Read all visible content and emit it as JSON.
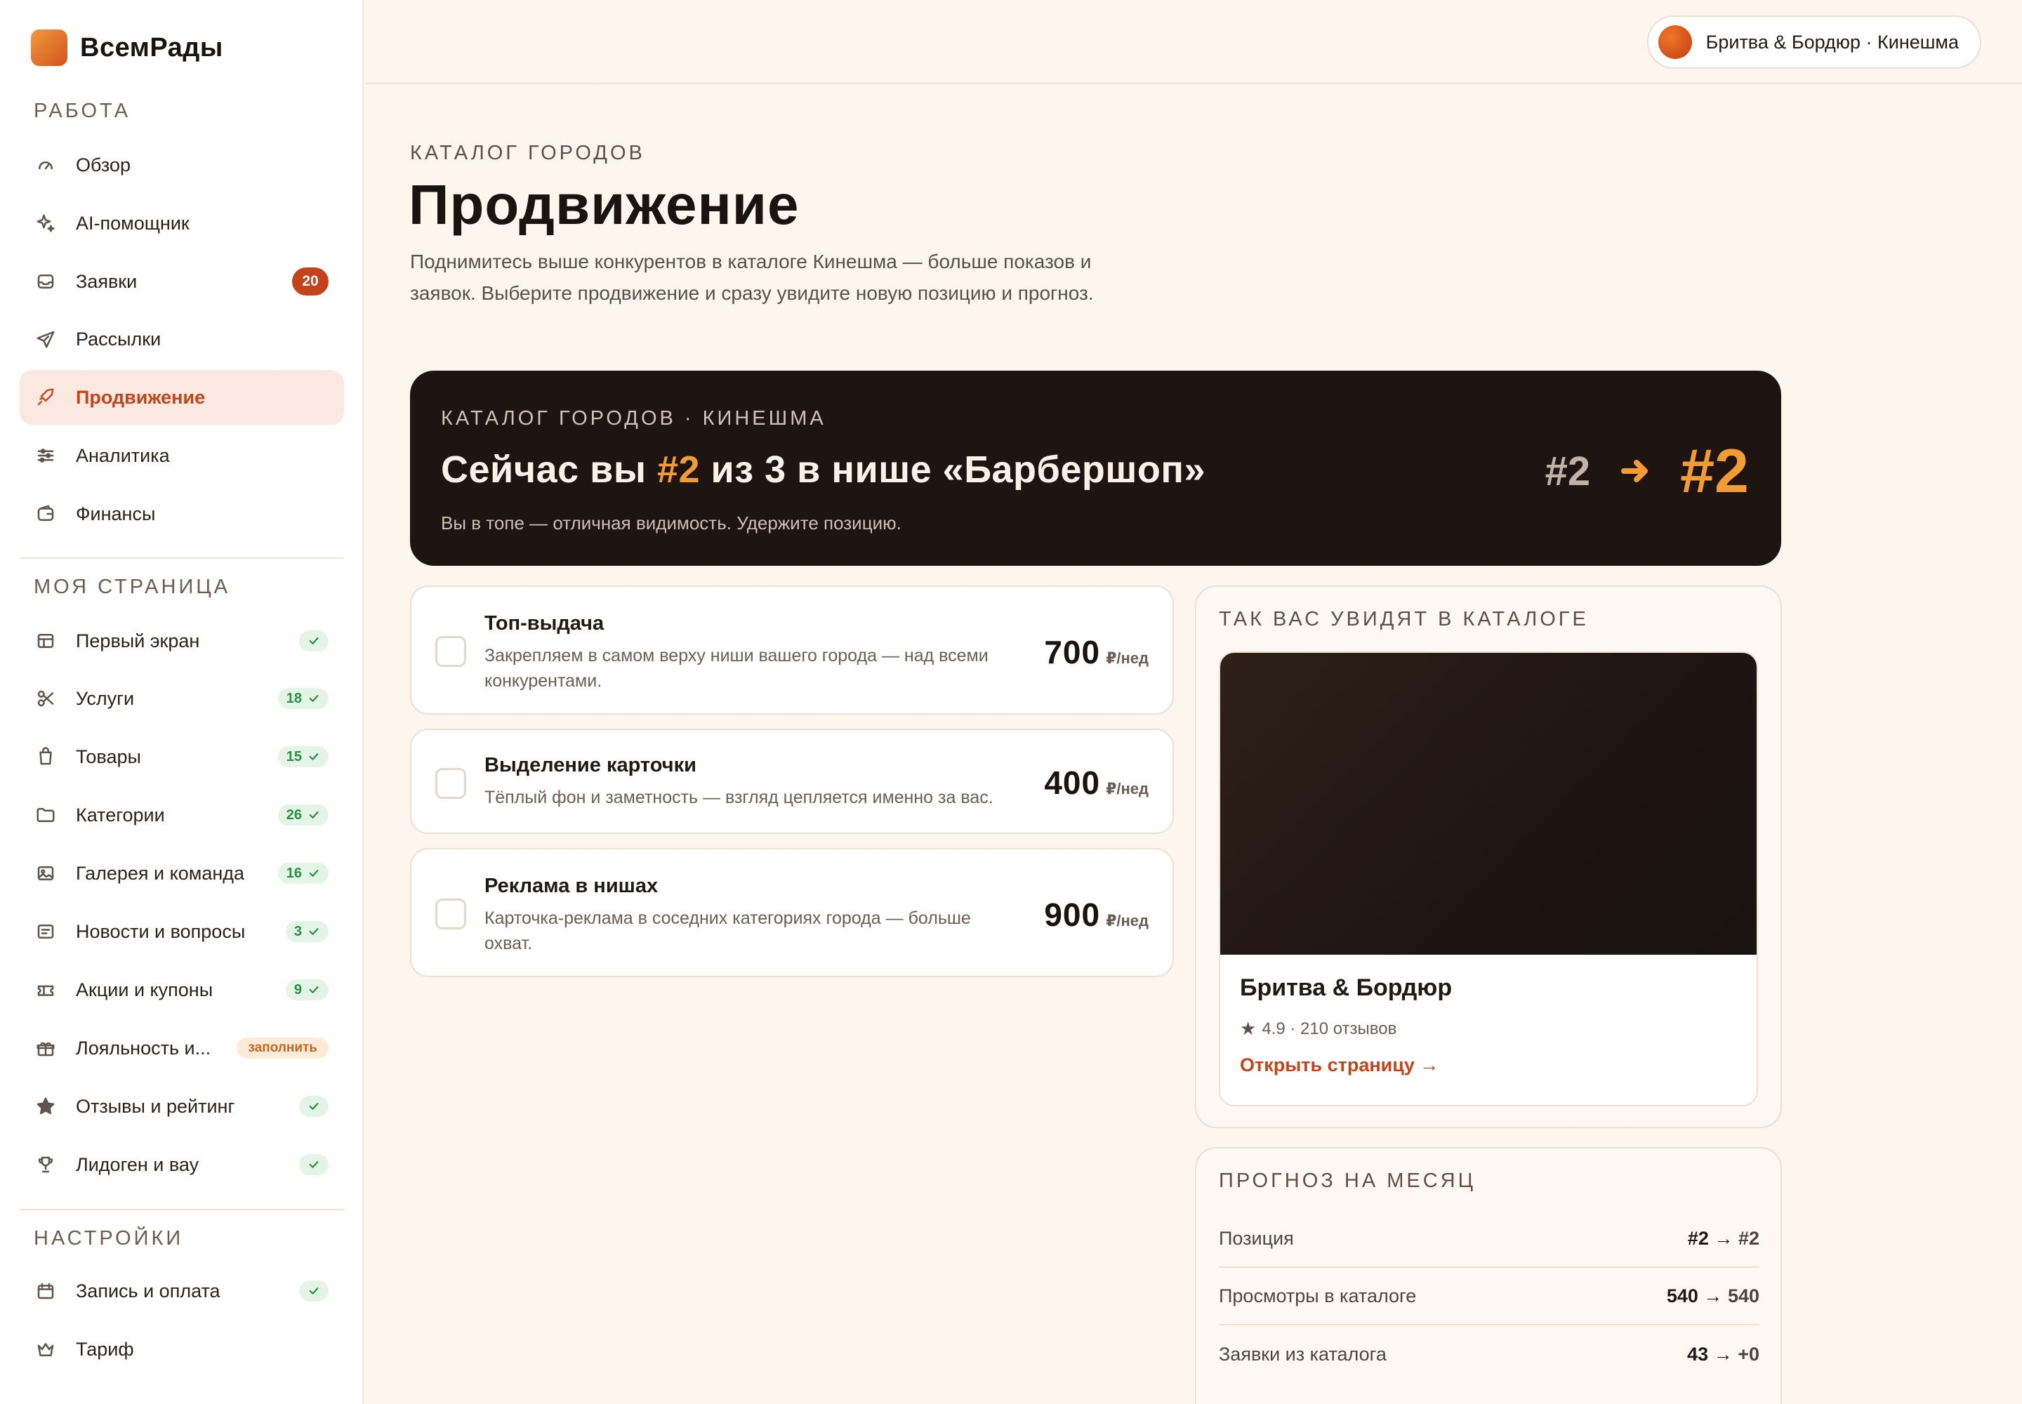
{
  "app": {
    "name": "ВсемРады",
    "brand_color": "#d2541c",
    "accent_color": "#f29c33"
  },
  "sidebar": {
    "sections": {
      "work": "РАБОТА",
      "my_page": "МОЯ СТРАНИЦА",
      "settings": "НАСТРОЙКИ"
    },
    "work_items": [
      {
        "label": "Обзор",
        "icon": "gauge-icon"
      },
      {
        "label": "AI-помощник",
        "icon": "sparkle-icon"
      },
      {
        "label": "Заявки",
        "icon": "inbox-icon",
        "badge": "20"
      },
      {
        "label": "Рассылки",
        "icon": "send-icon"
      },
      {
        "label": "Продвижение",
        "icon": "rocket-icon",
        "active": true
      },
      {
        "label": "Аналитика",
        "icon": "sliders-icon"
      },
      {
        "label": "Финансы",
        "icon": "wallet-icon"
      }
    ],
    "page_items": [
      {
        "label": "Первый экран",
        "icon": "layout-icon",
        "status": ""
      },
      {
        "label": "Услуги",
        "icon": "scissors-icon",
        "status": "18"
      },
      {
        "label": "Товары",
        "icon": "bag-icon",
        "status": "15"
      },
      {
        "label": "Категории",
        "icon": "folder-icon",
        "status": "26"
      },
      {
        "label": "Галерея и команда",
        "icon": "image-icon",
        "status": "16"
      },
      {
        "label": "Новости и вопросы",
        "icon": "news-icon",
        "status": "3"
      },
      {
        "label": "Акции и купоны",
        "icon": "ticket-icon",
        "status": "9"
      },
      {
        "label": "Лояльность и...",
        "icon": "gift-icon",
        "status_text": "заполнить"
      },
      {
        "label": "Отзывы и рейтинг",
        "icon": "star-icon",
        "status": ""
      },
      {
        "label": "Лидоген и вау",
        "icon": "trophy-icon",
        "status": ""
      }
    ],
    "settings_items": [
      {
        "label": "Запись и оплата",
        "icon": "calendar-icon",
        "status": ""
      },
      {
        "label": "Тариф",
        "icon": "crown-icon"
      }
    ]
  },
  "topbar": {
    "business": "Бритва & Бордюр · Кинешма"
  },
  "main": {
    "eyebrow": "КАТАЛОГ ГОРОДОВ",
    "title": "Продвижение",
    "description": "Поднимитесь выше конкурентов в каталоге Кинешма — больше показов и заявок. Выберите продвижение и сразу увидите новую позицию и прогноз.",
    "hero": {
      "eyebrow": "КАТАЛОГ ГОРОДОВ · КИНЕШМА",
      "title_pre": "Сейчас вы ",
      "title_rank": "#2",
      "title_post": " из 3 в нише «Барбершоп»",
      "subtitle": "Вы в топе — отличная видимость. Удержите позицию.",
      "rank_from": "#2",
      "rank_to": "#2"
    },
    "options": [
      {
        "title": "Топ-выдача",
        "desc": "Закрепляем в самом верху ниши вашего города — над всеми конкурентами.",
        "price": "700",
        "unit": "₽/нед"
      },
      {
        "title": "Выделение карточки",
        "desc": "Тёплый фон и заметность — взгляд цепляется именно за вас.",
        "price": "400",
        "unit": "₽/нед"
      },
      {
        "title": "Реклама в нишах",
        "desc": "Карточка-реклама в соседних категориях города — больше охват.",
        "price": "900",
        "unit": "₽/нед"
      }
    ],
    "preview": {
      "eyebrow": "ТАК ВАС УВИДЯТ В КАТАЛОГЕ",
      "name": "Бритва & Бордюр",
      "rating": "4.9 · 210 отзывов",
      "link": "Открыть страницу →"
    },
    "forecast": {
      "eyebrow": "ПРОГНОЗ НА МЕСЯЦ",
      "rows": [
        {
          "label": "Позиция",
          "from": "#2",
          "to": "#2"
        },
        {
          "label": "Просмотры в каталоге",
          "from": "540",
          "to": "540"
        },
        {
          "label": "Заявки из каталога",
          "from": "43",
          "to": "+0"
        }
      ]
    }
  }
}
